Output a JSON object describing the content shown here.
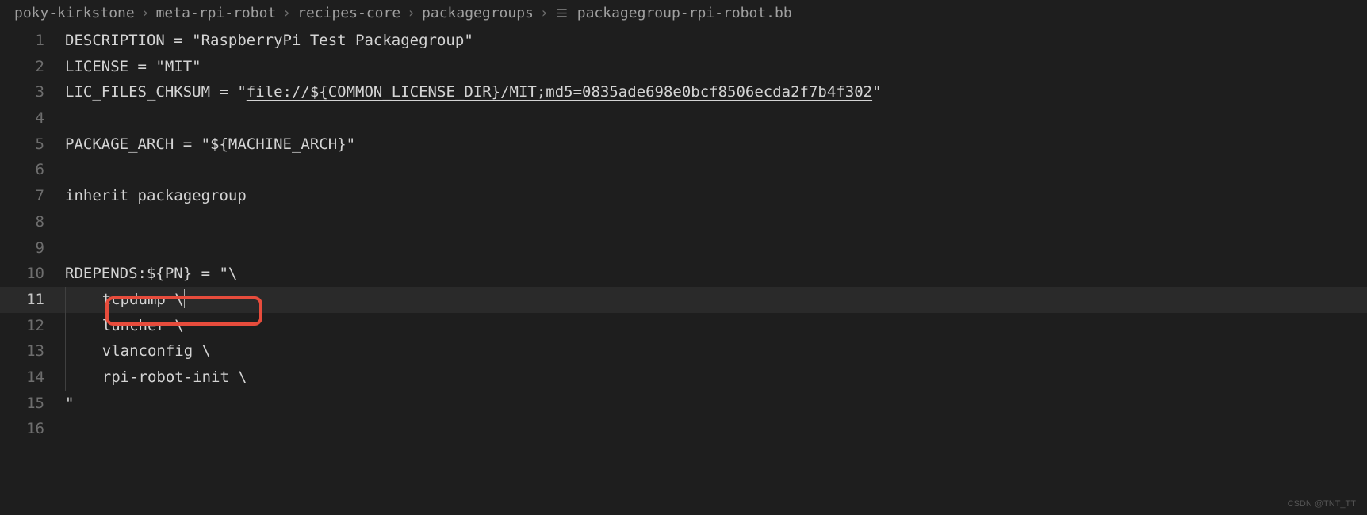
{
  "breadcrumb": {
    "segments": [
      "poky-kirkstone",
      "meta-rpi-robot",
      "recipes-core",
      "packagegroups",
      "packagegroup-rpi-robot.bb"
    ]
  },
  "editor": {
    "active_line": 11,
    "lines": [
      {
        "n": 1,
        "raw": "DESCRIPTION = \"RaspberryPi Test Packagegroup\""
      },
      {
        "n": 2,
        "raw": "LICENSE = \"MIT\""
      },
      {
        "n": 3,
        "prefix": "LIC_FILES_CHKSUM = \"",
        "underlined": "file://${COMMON_LICENSE_DIR}/MIT;md5=0835ade698e0bcf8506ecda2f7b4f302",
        "suffix": "\""
      },
      {
        "n": 4,
        "raw": ""
      },
      {
        "n": 5,
        "raw": "PACKAGE_ARCH = \"${MACHINE_ARCH}\""
      },
      {
        "n": 6,
        "raw": ""
      },
      {
        "n": 7,
        "raw": "inherit packagegroup"
      },
      {
        "n": 8,
        "raw": ""
      },
      {
        "n": 9,
        "raw": ""
      },
      {
        "n": 10,
        "raw": "RDEPENDS:${PN} = \"\\"
      },
      {
        "n": 11,
        "indent": true,
        "raw": "    tcpdump \\",
        "cursor": true
      },
      {
        "n": 12,
        "indent": true,
        "raw": "    luncher \\"
      },
      {
        "n": 13,
        "indent": true,
        "raw": "    vlanconfig \\"
      },
      {
        "n": 14,
        "indent": true,
        "raw": "    rpi-robot-init \\"
      },
      {
        "n": 15,
        "raw": "\""
      },
      {
        "n": 16,
        "raw": ""
      }
    ]
  },
  "watermark": "CSDN @TNT_TT"
}
